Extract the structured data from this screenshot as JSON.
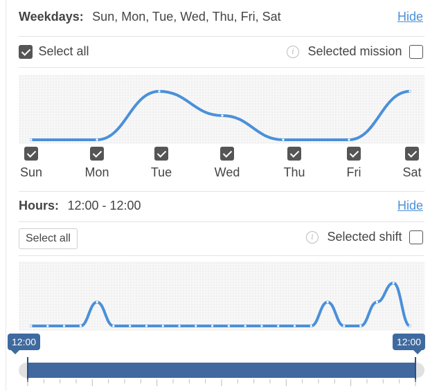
{
  "weekdays": {
    "label": "Weekdays:",
    "value": "Sun, Mon, Tue, Wed, Thu, Fri, Sat",
    "hide_label": "Hide",
    "select_all_label": "Select all",
    "select_all_checked": true,
    "selected_mission_label": "Selected mission",
    "selected_mission_checked": false,
    "days": [
      {
        "label": "Sun",
        "checked": true
      },
      {
        "label": "Mon",
        "checked": true
      },
      {
        "label": "Tue",
        "checked": true
      },
      {
        "label": "Wed",
        "checked": true
      },
      {
        "label": "Thu",
        "checked": true
      },
      {
        "label": "Fri",
        "checked": true
      },
      {
        "label": "Sat",
        "checked": true
      }
    ]
  },
  "hours": {
    "label": "Hours:",
    "value": "12:00 - 12:00",
    "hide_label": "Hide",
    "select_all_label": "Select all",
    "selected_shift_label": "Selected shift",
    "selected_shift_checked": false,
    "range_start_label": "12:00",
    "range_end_label": "12:00"
  },
  "colors": {
    "line": "#4a90d9",
    "slider_fill": "#41689f",
    "bubble": "#3f6a9f",
    "link": "#4a90d9"
  },
  "chart_data": [
    {
      "type": "line",
      "categories": [
        "Sun",
        "Mon",
        "Tue",
        "Wed",
        "Thu",
        "Fri",
        "Sat"
      ],
      "values": [
        0,
        0,
        1.0,
        0.5,
        0,
        0,
        1.0
      ],
      "ylim": [
        0,
        1
      ],
      "grid": false
    },
    {
      "type": "line",
      "x": [
        0,
        1,
        2,
        3,
        4,
        5,
        6,
        7,
        8,
        9,
        10,
        11,
        12,
        13,
        14,
        15,
        16,
        17,
        18,
        19,
        20,
        21,
        22,
        23
      ],
      "values": [
        0,
        0,
        0,
        0,
        1,
        0,
        0,
        0,
        0,
        0,
        0,
        0,
        0,
        0,
        0,
        0,
        0,
        0,
        1,
        0,
        0,
        1,
        1.8,
        0
      ],
      "ylim": [
        0,
        2
      ],
      "grid": false
    }
  ]
}
